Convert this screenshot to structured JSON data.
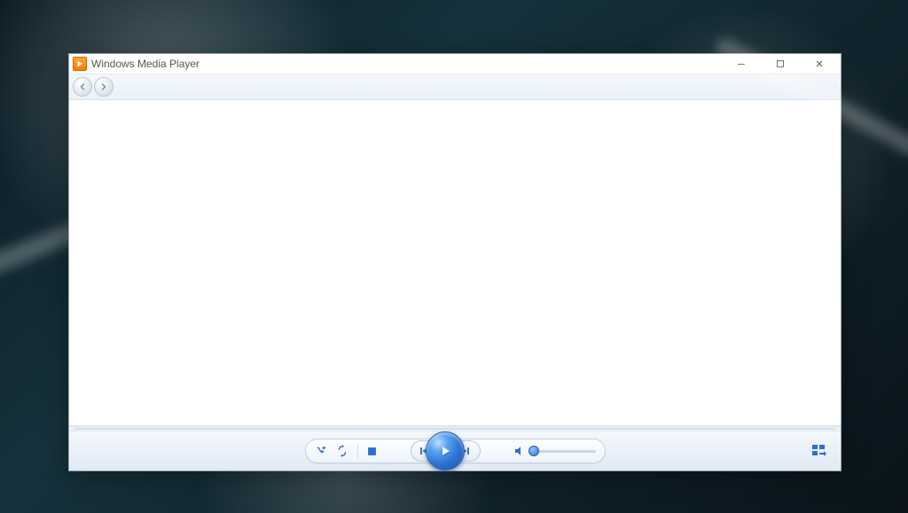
{
  "window": {
    "title": "Windows Media Player"
  },
  "icons": {
    "app": "wmp-play-icon",
    "minimize": "minimize-icon",
    "maximize": "maximize-icon",
    "close": "close-icon",
    "back": "back-icon",
    "forward": "forward-icon",
    "shuffle": "shuffle-icon",
    "repeat": "repeat-icon",
    "stop": "stop-icon",
    "previous": "previous-icon",
    "play": "play-icon",
    "next": "next-icon",
    "mute": "speaker-icon",
    "switch_view": "switch-to-library-icon"
  },
  "playback": {
    "volume_percent": 0
  }
}
